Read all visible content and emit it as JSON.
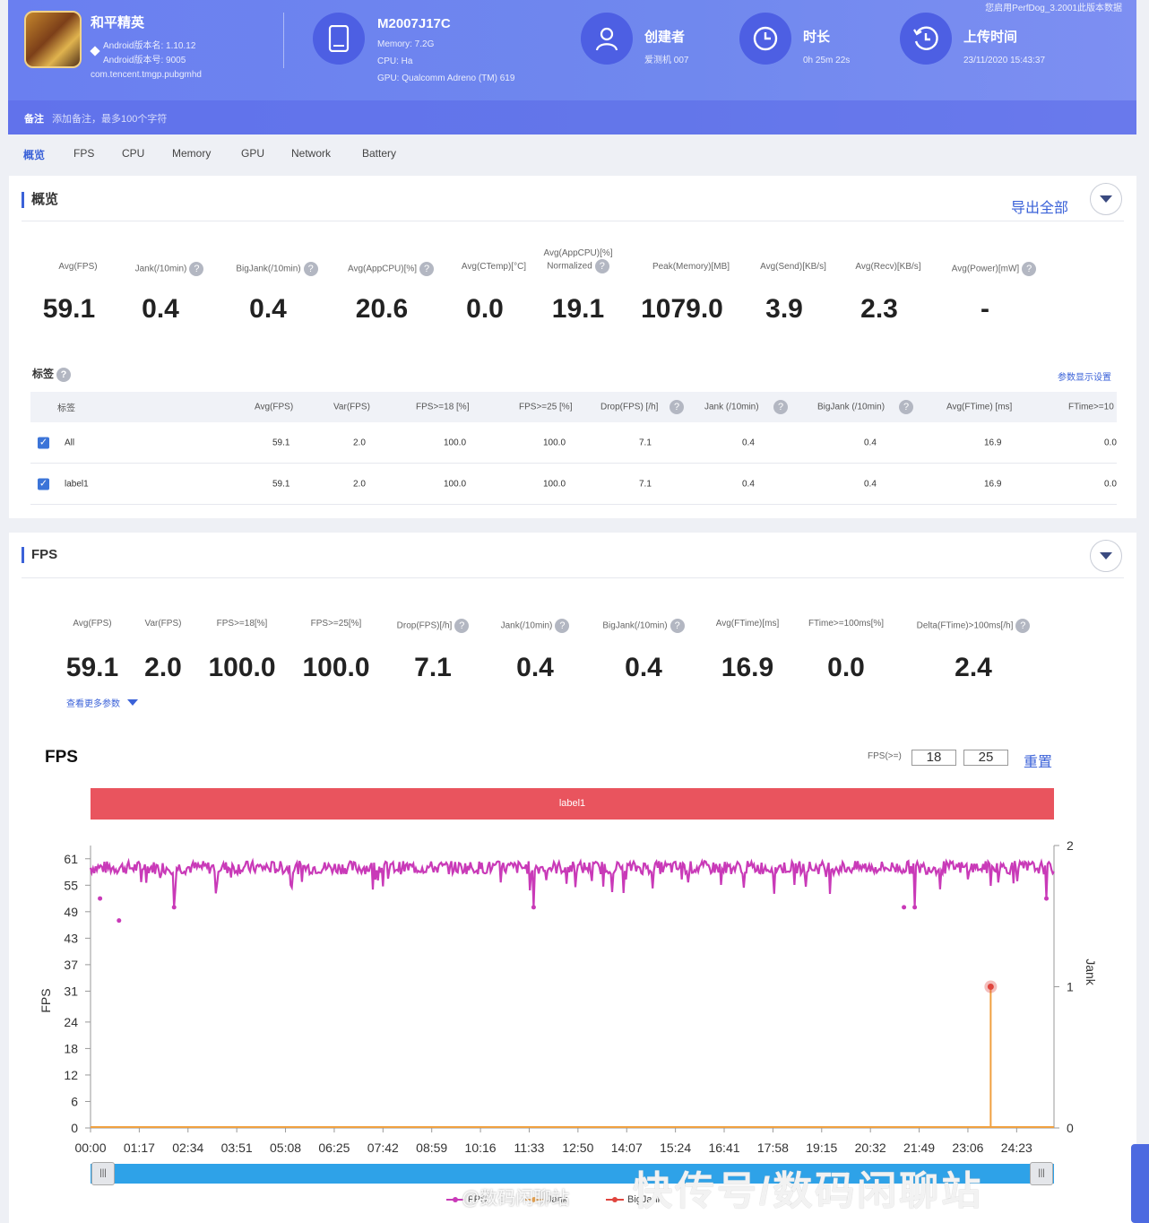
{
  "header": {
    "top_note": "您启用PerfDog_3.2001此版本数据",
    "app": {
      "name": "和平精英",
      "version_line": "Android版本名: 1.10.12",
      "version_code_line": "Android版本号: 9005",
      "package": "com.tencent.tmgp.pubgmhd"
    },
    "device": {
      "model": "M2007J17C",
      "memory": "Memory: 7.2G",
      "cpu": "CPU: Ha",
      "gpu": "GPU: Qualcomm Adreno (TM) 619"
    },
    "creator": {
      "title": "创建者",
      "value": "爱测机 007"
    },
    "duration": {
      "title": "时长",
      "value": "0h 25m 22s"
    },
    "upload": {
      "title": "上传时间",
      "value": "23/11/2020 15:43:37"
    },
    "note": {
      "label": "备注",
      "placeholder": "添加备注，最多100个字符"
    }
  },
  "tabs": [
    {
      "label": "概览",
      "active": true
    },
    {
      "label": "FPS",
      "active": false
    },
    {
      "label": "CPU",
      "active": false
    },
    {
      "label": "Memory",
      "active": false
    },
    {
      "label": "GPU",
      "active": false
    },
    {
      "label": "Network",
      "active": false
    },
    {
      "label": "Battery",
      "active": false
    }
  ],
  "overview": {
    "title": "概览",
    "export_label": "导出全部",
    "stats": [
      {
        "label": "Avg(FPS)",
        "value": "59.1",
        "help": false
      },
      {
        "label": "Jank(/10min)",
        "value": "0.4",
        "help": true
      },
      {
        "label": "BigJank(/10min)",
        "value": "0.4",
        "help": true
      },
      {
        "label": "Avg(AppCPU)[%]",
        "value": "20.6",
        "help": true
      },
      {
        "label": "Avg(CTemp)[°C]",
        "value": "0.0",
        "help": false
      },
      {
        "label": "Avg(AppCPU)[%] Normalized",
        "value": "19.1",
        "help": true
      },
      {
        "label": "Peak(Memory)[MB]",
        "value": "1079.0",
        "help": false
      },
      {
        "label": "Avg(Send)[KB/s]",
        "value": "3.9",
        "help": false
      },
      {
        "label": "Avg(Recv)[KB/s]",
        "value": "2.3",
        "help": false
      },
      {
        "label": "Avg(Power)[mW]",
        "value": "-",
        "help": true
      }
    ],
    "label_section": "标签",
    "label_settings": "参数显示设置",
    "table": {
      "headers": [
        "标签",
        "Avg(FPS)",
        "Var(FPS)",
        "FPS>=18 [%]",
        "FPS>=25 [%]",
        "Drop(FPS) [/h]",
        "Jank (/10min)",
        "BigJank (/10min)",
        "Avg(FTime) [ms]",
        "FTime>=10"
      ],
      "rows": [
        [
          "All",
          "59.1",
          "2.0",
          "100.0",
          "100.0",
          "7.1",
          "0.4",
          "0.4",
          "16.9",
          "0.0"
        ],
        [
          "label1",
          "59.1",
          "2.0",
          "100.0",
          "100.0",
          "7.1",
          "0.4",
          "0.4",
          "16.9",
          "0.0"
        ]
      ]
    }
  },
  "fps_section": {
    "title": "FPS",
    "stats": [
      {
        "label": "Avg(FPS)",
        "value": "59.1",
        "help": false
      },
      {
        "label": "Var(FPS)",
        "value": "2.0",
        "help": false
      },
      {
        "label": "FPS>=18[%]",
        "value": "100.0",
        "help": false
      },
      {
        "label": "FPS>=25[%]",
        "value": "100.0",
        "help": false
      },
      {
        "label": "Drop(FPS)[/h]",
        "value": "7.1",
        "help": true
      },
      {
        "label": "Jank(/10min)",
        "value": "0.4",
        "help": true
      },
      {
        "label": "BigJank(/10min)",
        "value": "0.4",
        "help": true
      },
      {
        "label": "Avg(FTime)[ms]",
        "value": "16.9",
        "help": false
      },
      {
        "label": "FTime>=100ms[%]",
        "value": "0.0",
        "help": false
      },
      {
        "label": "Delta(FTime)>100ms[/h]",
        "value": "2.4",
        "help": true
      }
    ],
    "more_params": "查看更多参数",
    "chart_title": "FPS",
    "threshold_label": "FPS(>=)",
    "threshold_1": "18",
    "threshold_2": "25",
    "reset_label": "重置",
    "band_label": "label1",
    "handle_left": "|||",
    "handle_right": "|||",
    "legend": [
      "FPS",
      "Jank",
      "BigJank"
    ]
  },
  "chart_data": {
    "type": "line",
    "title": "FPS",
    "xlabel": "",
    "ylabel": "FPS",
    "y2label": "Jank",
    "ylim": [
      0,
      64
    ],
    "y2lim": [
      0,
      2
    ],
    "yticks": [
      0,
      6,
      12,
      18,
      24,
      31,
      37,
      43,
      49,
      55,
      61
    ],
    "y2ticks": [
      0,
      1,
      2
    ],
    "xticks": [
      "00:00",
      "01:17",
      "02:34",
      "03:51",
      "05:08",
      "06:25",
      "07:42",
      "08:59",
      "10:16",
      "11:33",
      "12:50",
      "14:07",
      "15:24",
      "16:41",
      "17:58",
      "19:15",
      "20:32",
      "21:49",
      "23:06",
      "24:23"
    ],
    "duration_seconds": 1522,
    "series": [
      {
        "name": "FPS",
        "color": "#c93ab8",
        "baseline": 59,
        "dips": [
          [
            15,
            52
          ],
          [
            45,
            47
          ],
          [
            132,
            50
          ],
          [
            700,
            50
          ],
          [
            1285,
            50
          ],
          [
            1302,
            50
          ],
          [
            1510,
            52
          ]
        ]
      },
      {
        "name": "Jank",
        "color": "#f0a040",
        "events": [
          [
            1422,
            1
          ]
        ]
      },
      {
        "name": "BigJank",
        "color": "#e0453e",
        "events": [
          [
            1422,
            1
          ]
        ]
      }
    ]
  },
  "watermark": {
    "left": "快传号/数码闲聊站",
    "weibo": "@数码闲聊站"
  },
  "colors": {
    "accent": "#3b62d8",
    "header": "#6a7ff0",
    "band": "#e9545e",
    "slider": "#2ea2e8"
  }
}
